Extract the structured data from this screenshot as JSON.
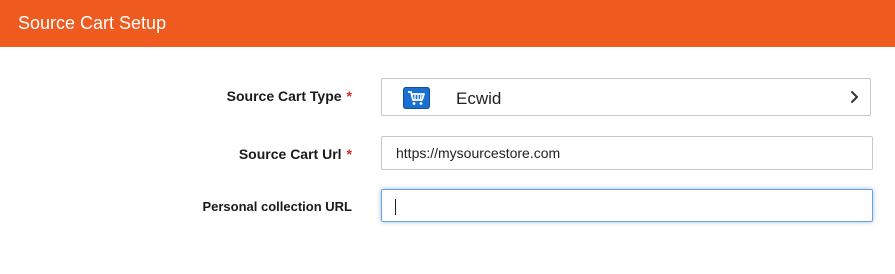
{
  "header": {
    "title": "Source Cart Setup"
  },
  "form": {
    "source_cart_type": {
      "label": "Source Cart Type",
      "required_mark": "*",
      "selected_value": "Ecwid",
      "logo_icon": "ecwid-cart-icon",
      "chevron_icon": "chevron-right-icon"
    },
    "source_cart_url": {
      "label": "Source Cart Url",
      "required_mark": "*",
      "value": "https://mysourcestore.com"
    },
    "personal_collection_url": {
      "label": "Personal collection URL",
      "value": ""
    }
  },
  "colors": {
    "header_bg": "#ef5a1f",
    "required": "#d9262b",
    "focus_border": "#6aa3e2",
    "ecwid_blue": "#1b6fd1"
  }
}
